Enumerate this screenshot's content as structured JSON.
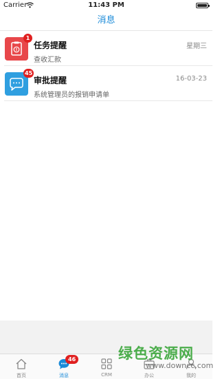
{
  "status_bar": {
    "carrier": "Carrier",
    "time": "11:43 PM"
  },
  "nav": {
    "title": "消息"
  },
  "messages": [
    {
      "title": "任务提醒",
      "subtitle": "查收汇款",
      "date": "星期三",
      "badge": "1",
      "color": "#e8474a"
    },
    {
      "title": "审批提醒",
      "subtitle": "系统管理员的报销申请单",
      "date": "16-03-23",
      "badge": "45",
      "color": "#2f9fe0"
    }
  ],
  "tab_bar": {
    "active_color": "#1a8ad8",
    "tabs": [
      {
        "label": "首页",
        "icon": "home-icon"
      },
      {
        "label": "消息",
        "icon": "chat-bubble-icon",
        "badge": "46"
      },
      {
        "label": "CRM",
        "icon": "grid-icon"
      },
      {
        "label": "办公",
        "icon": "briefcase-icon"
      },
      {
        "label": "我的",
        "icon": "person-icon"
      }
    ]
  },
  "watermark": {
    "text_cn": "绿色资源网",
    "text_en": "www.downcc.com"
  }
}
